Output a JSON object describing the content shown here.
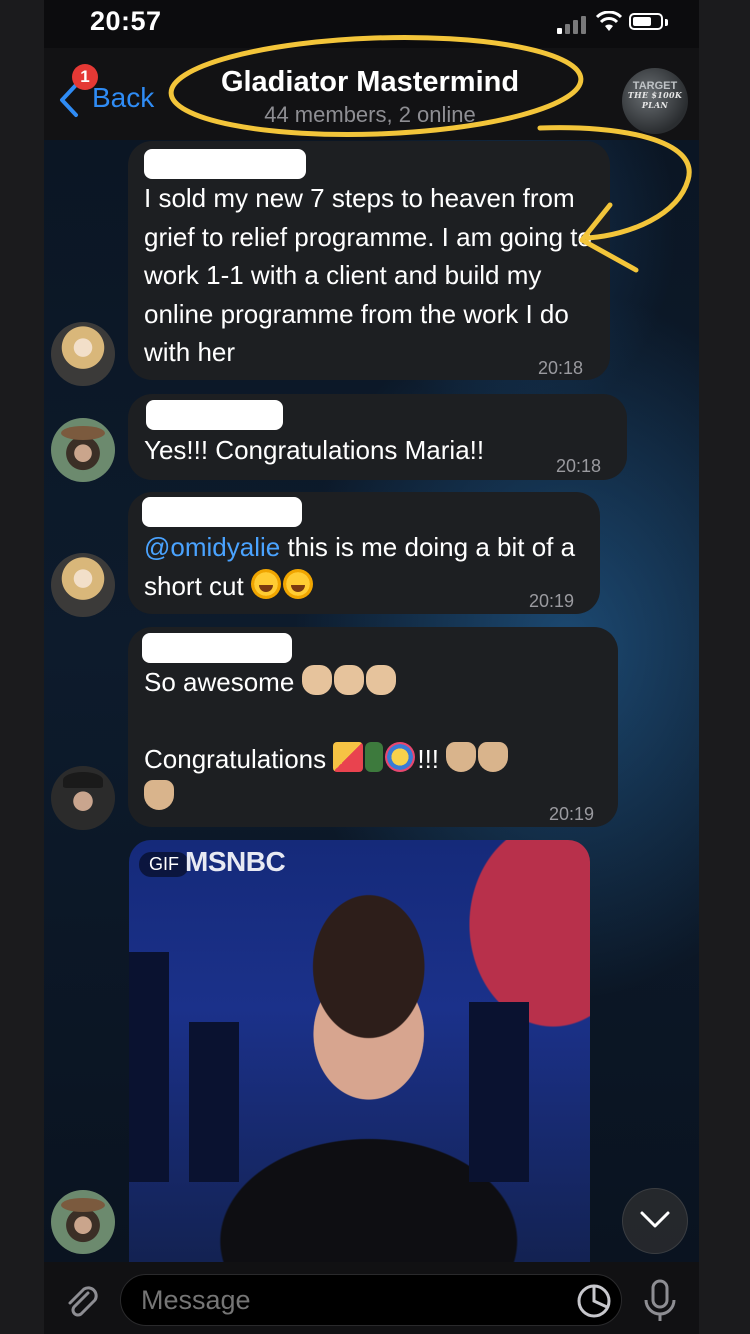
{
  "status": {
    "time": "20:57"
  },
  "header": {
    "back_label": "Back",
    "unread_badge": "1",
    "title": "Gladiator Mastermind",
    "subtitle": "44 members, 2 online",
    "group_avatar_top": "TARGET",
    "group_avatar_text": "THE $100K PLAN"
  },
  "messages": [
    {
      "text": "I sold my new 7 steps to heaven from grief to relief programme. I am going to work 1-1 with a client and build my online programme from the work I do with her",
      "time": "20:18",
      "avatar": "blonde-woman"
    },
    {
      "text": "Yes!!! Congratulations Maria!!",
      "time": "20:18",
      "avatar": "woman-with-hat"
    },
    {
      "mention": "@omidyalie",
      "text": " this is me doing a bit of a short cut",
      "time": "20:19",
      "avatar": "blonde-woman"
    },
    {
      "line1": "So awesome",
      "line2": "Congratulations",
      "line2_suffix": "!!!",
      "time": "20:19",
      "avatar": "man-with-hat"
    }
  ],
  "gif": {
    "label": "GIF",
    "network": "MSNBC"
  },
  "input": {
    "placeholder": "Message"
  },
  "colors": {
    "accent": "#2f8cf5",
    "bubble": "#1d1f22",
    "annotation": "#f3c53a",
    "badge": "#e53935"
  }
}
